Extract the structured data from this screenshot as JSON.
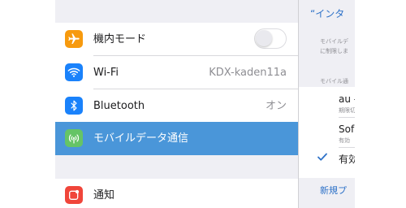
{
  "settings": {
    "airplane": {
      "label": "機内モード",
      "icon": "airplane-icon",
      "icon_color": "#f79a0e",
      "toggle_on": false
    },
    "wifi": {
      "label": "Wi-Fi",
      "value": "KDX-kaden11a",
      "icon": "wifi-icon",
      "icon_color": "#1a82fb"
    },
    "bluetooth": {
      "label": "Bluetooth",
      "value": "オン",
      "icon": "bluetooth-icon",
      "icon_color": "#1a82fb"
    },
    "mobile_data": {
      "label": "モバイルデータ通信",
      "icon": "antenna-icon",
      "icon_color": "#65c466",
      "selected": true
    },
    "notifications": {
      "label": "通知",
      "icon": "notification-icon",
      "icon_color": "#f0453a"
    }
  },
  "detail": {
    "title": "“インタ",
    "desc_line1": "モバイルデ",
    "desc_line2": "に制限しま",
    "section_header": "モバイル通",
    "items": [
      {
        "main": "au -",
        "sub": "期限切"
      },
      {
        "main": "Sof",
        "sub": "有効"
      },
      {
        "main": "有効",
        "checked": true
      }
    ],
    "new_link": "新規プ"
  },
  "colors": {
    "selection": "#4a96d9",
    "link": "#2e72c8",
    "background": "#efeff4"
  }
}
